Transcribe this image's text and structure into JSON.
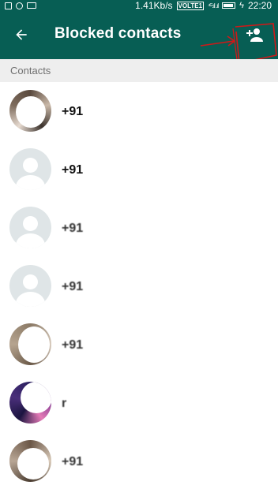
{
  "status_bar": {
    "network_speed": "1.41Kb/s",
    "volte": "VOLTE1",
    "signal": "⁴ᴳ.ıl .ıl",
    "charging": "ϟ",
    "time": "22:20"
  },
  "app_bar": {
    "title": "Blocked contacts",
    "back_icon": "arrow-left-icon",
    "add_icon": "add-person-icon",
    "color": "#075e54"
  },
  "section": {
    "header": "Contacts"
  },
  "contacts": [
    {
      "name": "+91",
      "avatar": "photo"
    },
    {
      "name": "+91",
      "avatar": "default"
    },
    {
      "name": "+91",
      "avatar": "default"
    },
    {
      "name": "+91",
      "avatar": "default"
    },
    {
      "name": "+91",
      "avatar": "photo"
    },
    {
      "name": "r",
      "avatar": "photo"
    },
    {
      "name": "+91",
      "avatar": "photo"
    }
  ],
  "annotation_color": "#d01818"
}
